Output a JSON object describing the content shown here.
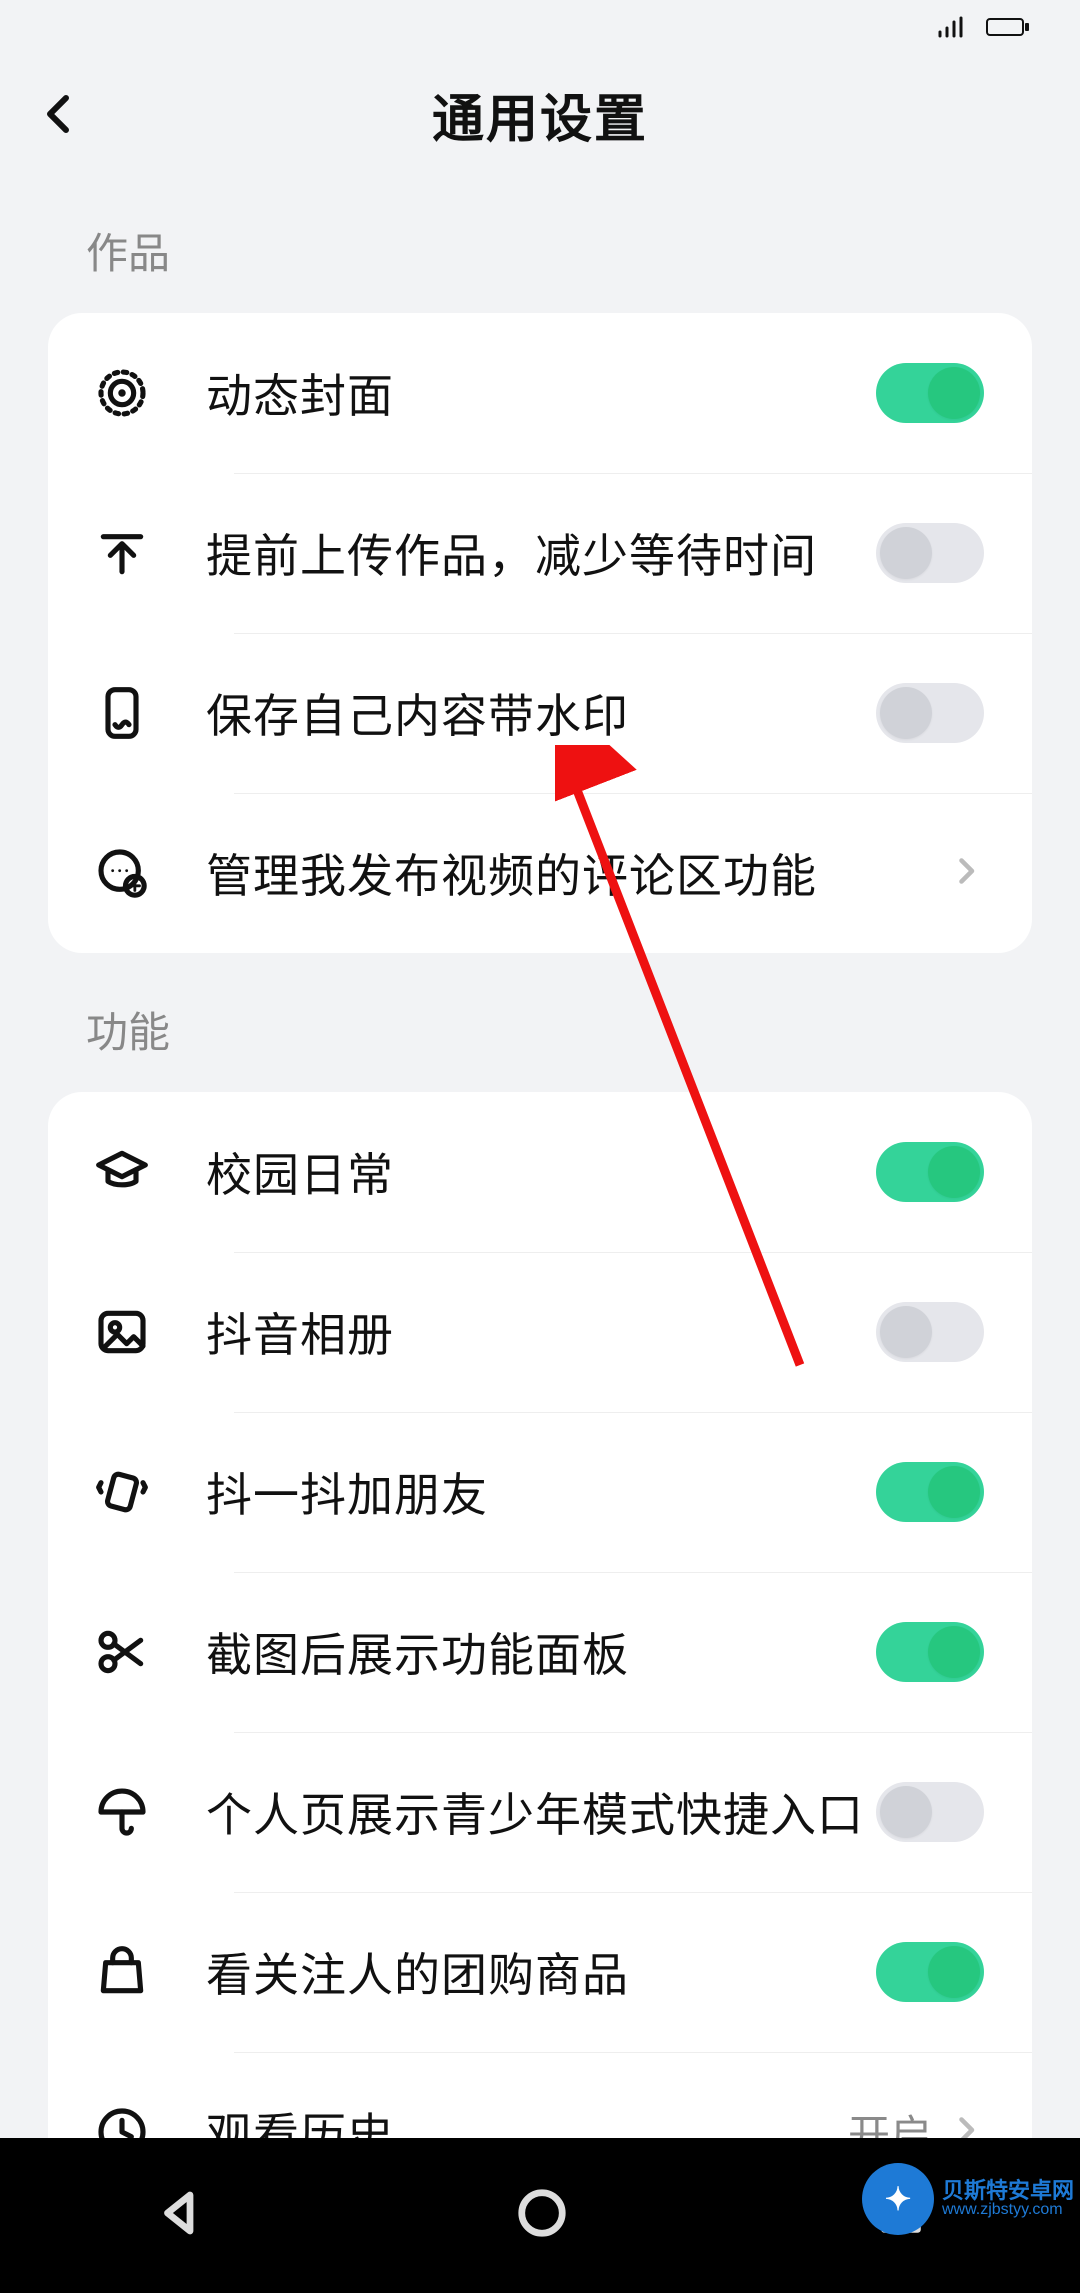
{
  "status": {
    "time": ""
  },
  "header": {
    "title": "通用设置"
  },
  "section1": {
    "label": "作品",
    "items": [
      {
        "label": "动态封面",
        "enabled": true
      },
      {
        "label": "提前上传作品，减少等待时间",
        "enabled": false
      },
      {
        "label": "保存自己内容带水印",
        "enabled": false
      },
      {
        "label": "管理我发布视频的评论区功能"
      }
    ]
  },
  "section2": {
    "label": "功能",
    "items": [
      {
        "label": "校园日常",
        "enabled": true
      },
      {
        "label": "抖音相册",
        "enabled": false
      },
      {
        "label": "抖一抖加朋友",
        "enabled": true
      },
      {
        "label": "截图后展示功能面板",
        "enabled": true
      },
      {
        "label": "个人页展示青少年模式快捷入口",
        "enabled": false
      },
      {
        "label": "看关注人的团购商品",
        "enabled": true
      },
      {
        "label": "观看历史",
        "value": "开启"
      }
    ]
  },
  "watermark": {
    "brand": "贝斯特安卓网",
    "url": "www.zjbstyy.com"
  }
}
